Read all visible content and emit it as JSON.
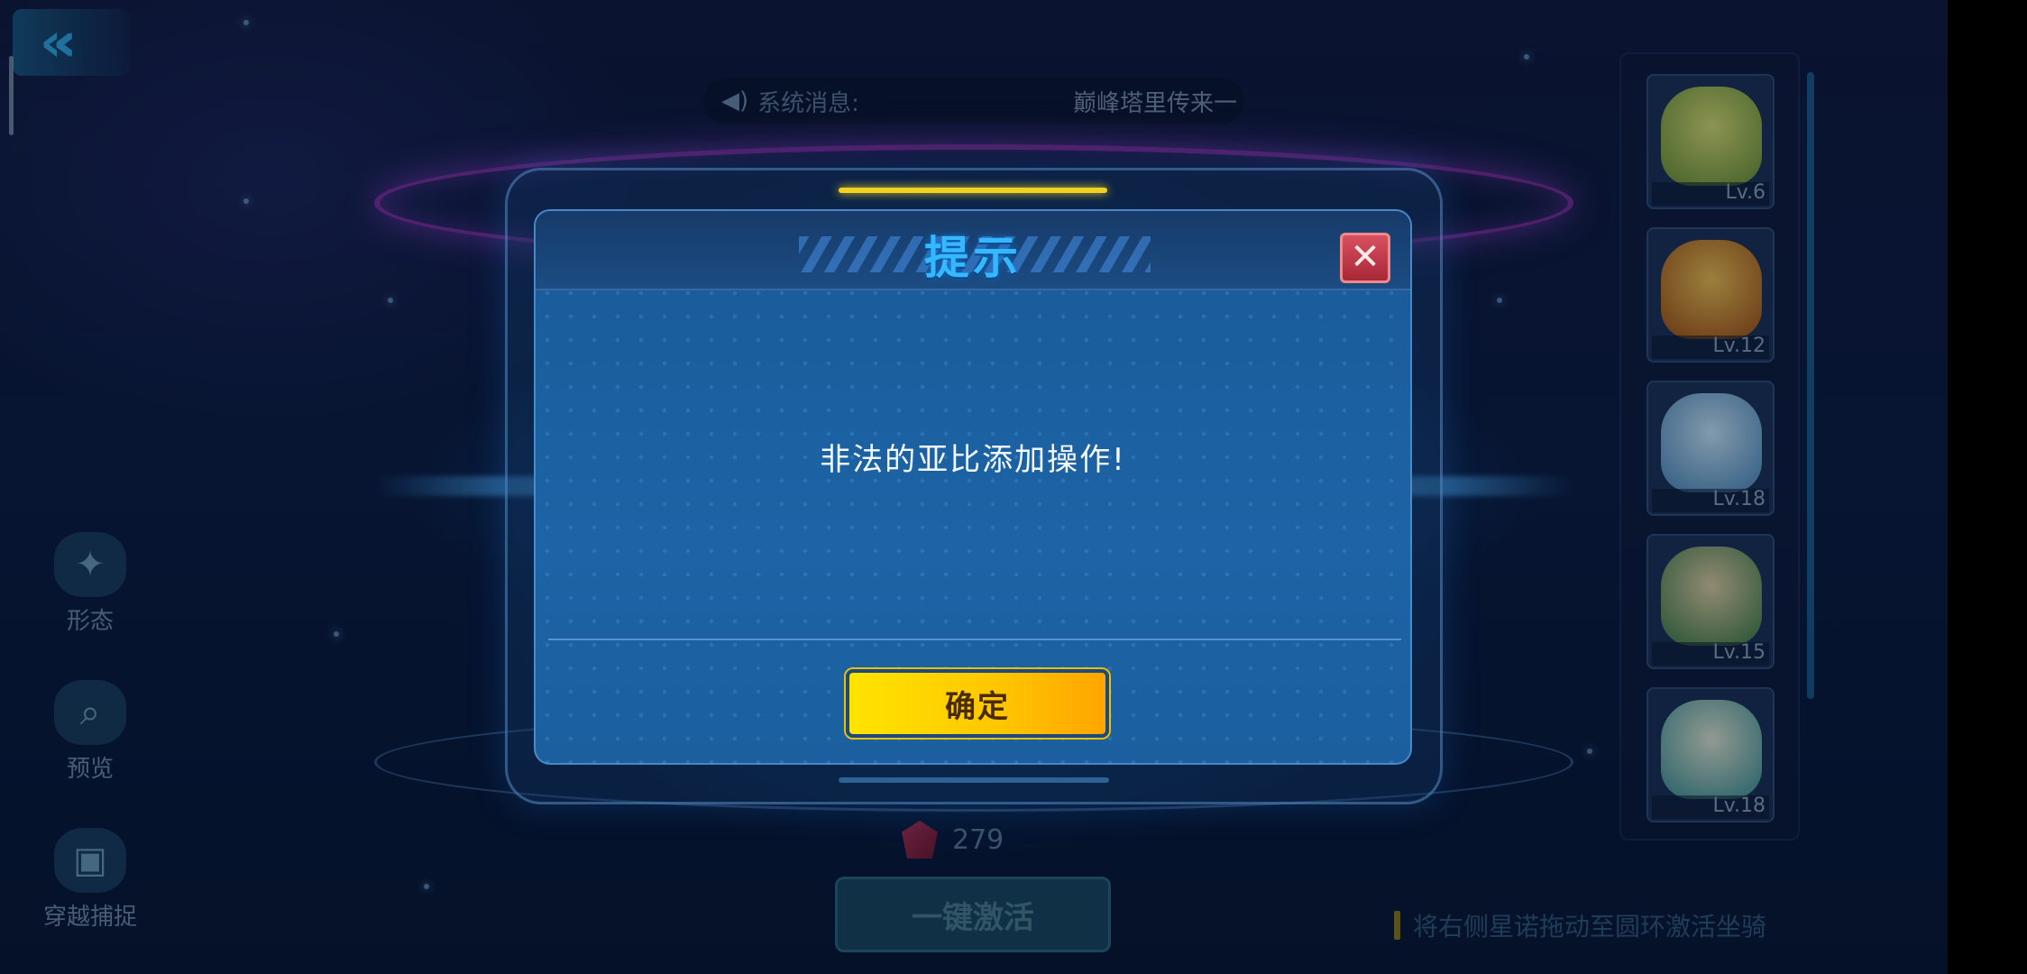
{
  "system_message": {
    "label": "系统消息:",
    "scroll_text": "巅峰塔里传来一"
  },
  "side_menu": [
    {
      "label": "形态",
      "icon": "form-icon"
    },
    {
      "label": "预览",
      "icon": "search-icon"
    },
    {
      "label": "穿越捕捉",
      "icon": "capture-icon"
    }
  ],
  "pets": [
    {
      "level": "Lv.6",
      "color": "#b8d060"
    },
    {
      "level": "Lv.12",
      "color": "#e0a030"
    },
    {
      "level": "Lv.18",
      "color": "#90c8e8"
    },
    {
      "level": "Lv.15",
      "color": "#60a060"
    },
    {
      "level": "Lv.18",
      "color": "#60b0a0"
    }
  ],
  "gem_count": "279",
  "activate_button": "一键激活",
  "hint": "将右侧星诺拖动至圆环激活坐骑",
  "dialog": {
    "title": "提示",
    "message": "非法的亚比添加操作!",
    "confirm_label": "确定",
    "close_label": "✕"
  },
  "colors": {
    "title": "#35b8ff",
    "confirm": "#ffc800",
    "close": "#d85060"
  }
}
